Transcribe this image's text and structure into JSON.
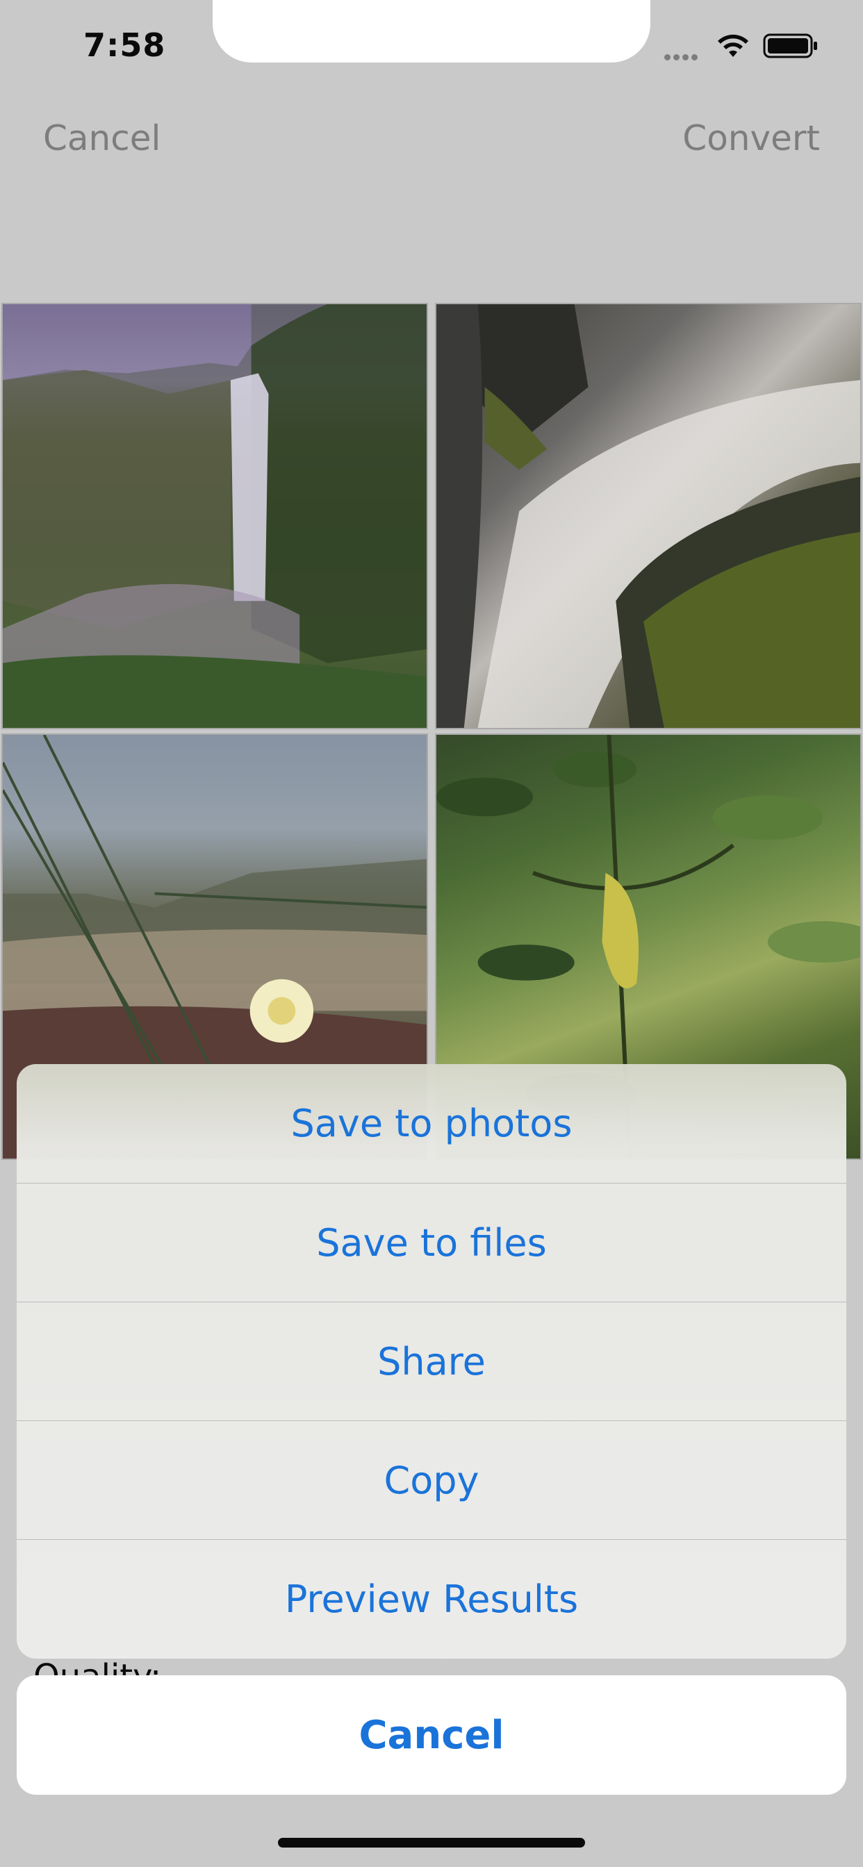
{
  "status_bar": {
    "time": "7:58"
  },
  "nav": {
    "cancel_label": "Cancel",
    "convert_label": "Convert"
  },
  "photos": [
    {
      "subject": "waterfall-canyon"
    },
    {
      "subject": "waterfall-rocks"
    },
    {
      "subject": "ice-plant-flower-dunes"
    },
    {
      "subject": "leaves"
    }
  ],
  "settings": {
    "quality_label": "Quality:"
  },
  "action_sheet": {
    "items": [
      {
        "label": "Save to photos"
      },
      {
        "label": "Save to files"
      },
      {
        "label": "Share"
      },
      {
        "label": "Copy"
      },
      {
        "label": "Preview Results"
      }
    ],
    "cancel_label": "Cancel"
  },
  "colors": {
    "accent": "#1a73d9",
    "nav_dimmed": "#7d7d7d",
    "overlay_bg": "#c9c9c9"
  }
}
